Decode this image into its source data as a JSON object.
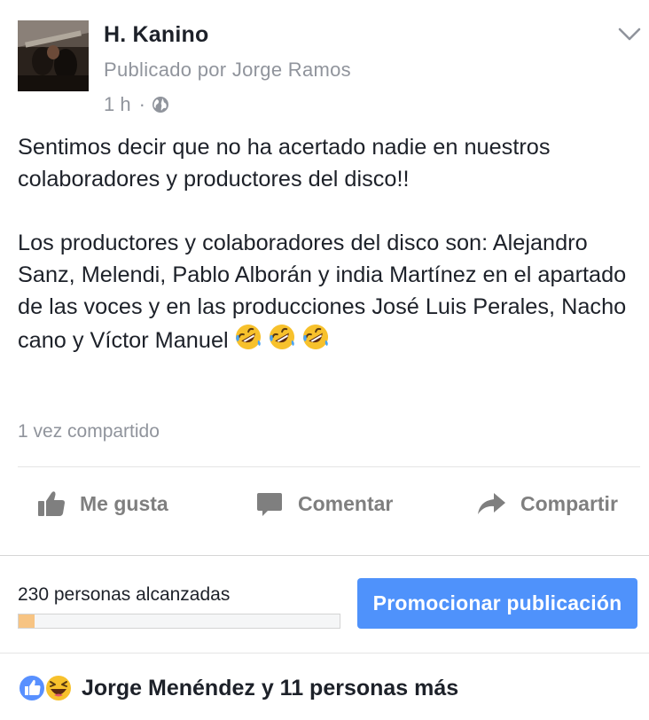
{
  "post": {
    "page_name": "H. Kanino",
    "published_by": "Publicado por Jorge Ramos",
    "time": "1 h",
    "separator": "·",
    "privacy_icon": "globe-icon",
    "menu_icon": "chevron-down-icon",
    "paragraph1": "Sentimos decir que no ha acertado nadie en nuestros colaboradores y productores del disco!!",
    "paragraph2": "Los productores y colaboradores del disco son: Alejandro Sanz, Melendi, Pablo Alborán y india Martínez en el apartado de las voces y en las producciones José Luis Perales, Nacho cano y Víctor Manuel",
    "emojis": [
      "rolling-on-floor-laughing",
      "rolling-on-floor-laughing",
      "rolling-on-floor-laughing"
    ],
    "shares": "1 vez compartido"
  },
  "actions": {
    "like": "Me gusta",
    "comment": "Comentar",
    "share": "Compartir"
  },
  "reach": {
    "text": "230 personas alcanzadas",
    "progress_fraction": 0.05,
    "fill_color": "#f7c483",
    "promote_label": "Promocionar publicación",
    "promote_color": "#4f92fb"
  },
  "reactions": {
    "icons": [
      "like-reaction-icon",
      "haha-reaction-icon"
    ],
    "text": "Jorge Menéndez y 11 personas más"
  }
}
